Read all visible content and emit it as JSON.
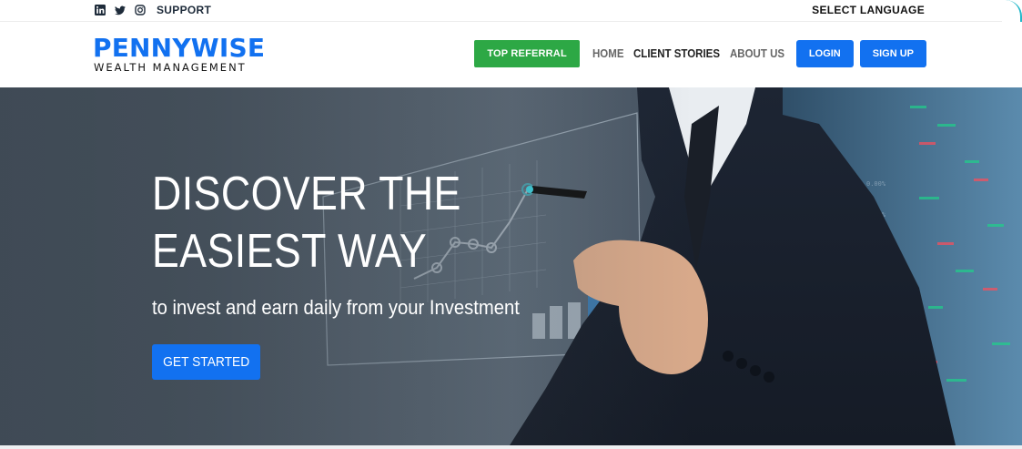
{
  "topbar": {
    "social_icons": [
      "linkedin-icon",
      "twitter-icon",
      "instagram-icon"
    ],
    "support_label": "SUPPORT",
    "language_label": "SELECT LANGUAGE"
  },
  "header": {
    "logo": {
      "main": "PENNYWISE",
      "sub": "WEALTH MANAGEMENT"
    },
    "nav": {
      "top_referral": "TOP REFERRAL",
      "home": "HOME",
      "client_stories": "CLIENT STORIES",
      "about_us": "ABOUT US",
      "login": "LOGIN",
      "sign_up": "SIGN UP"
    }
  },
  "hero": {
    "title_line1": "DISCOVER THE",
    "title_line2": "EASIEST WAY",
    "subtitle": "to invest and earn daily from your Investment",
    "cta_label": "GET STARTED"
  },
  "colors": {
    "brand_blue": "#1271f0",
    "referral_green": "#2da845",
    "hero_overlay": "#414c57"
  }
}
